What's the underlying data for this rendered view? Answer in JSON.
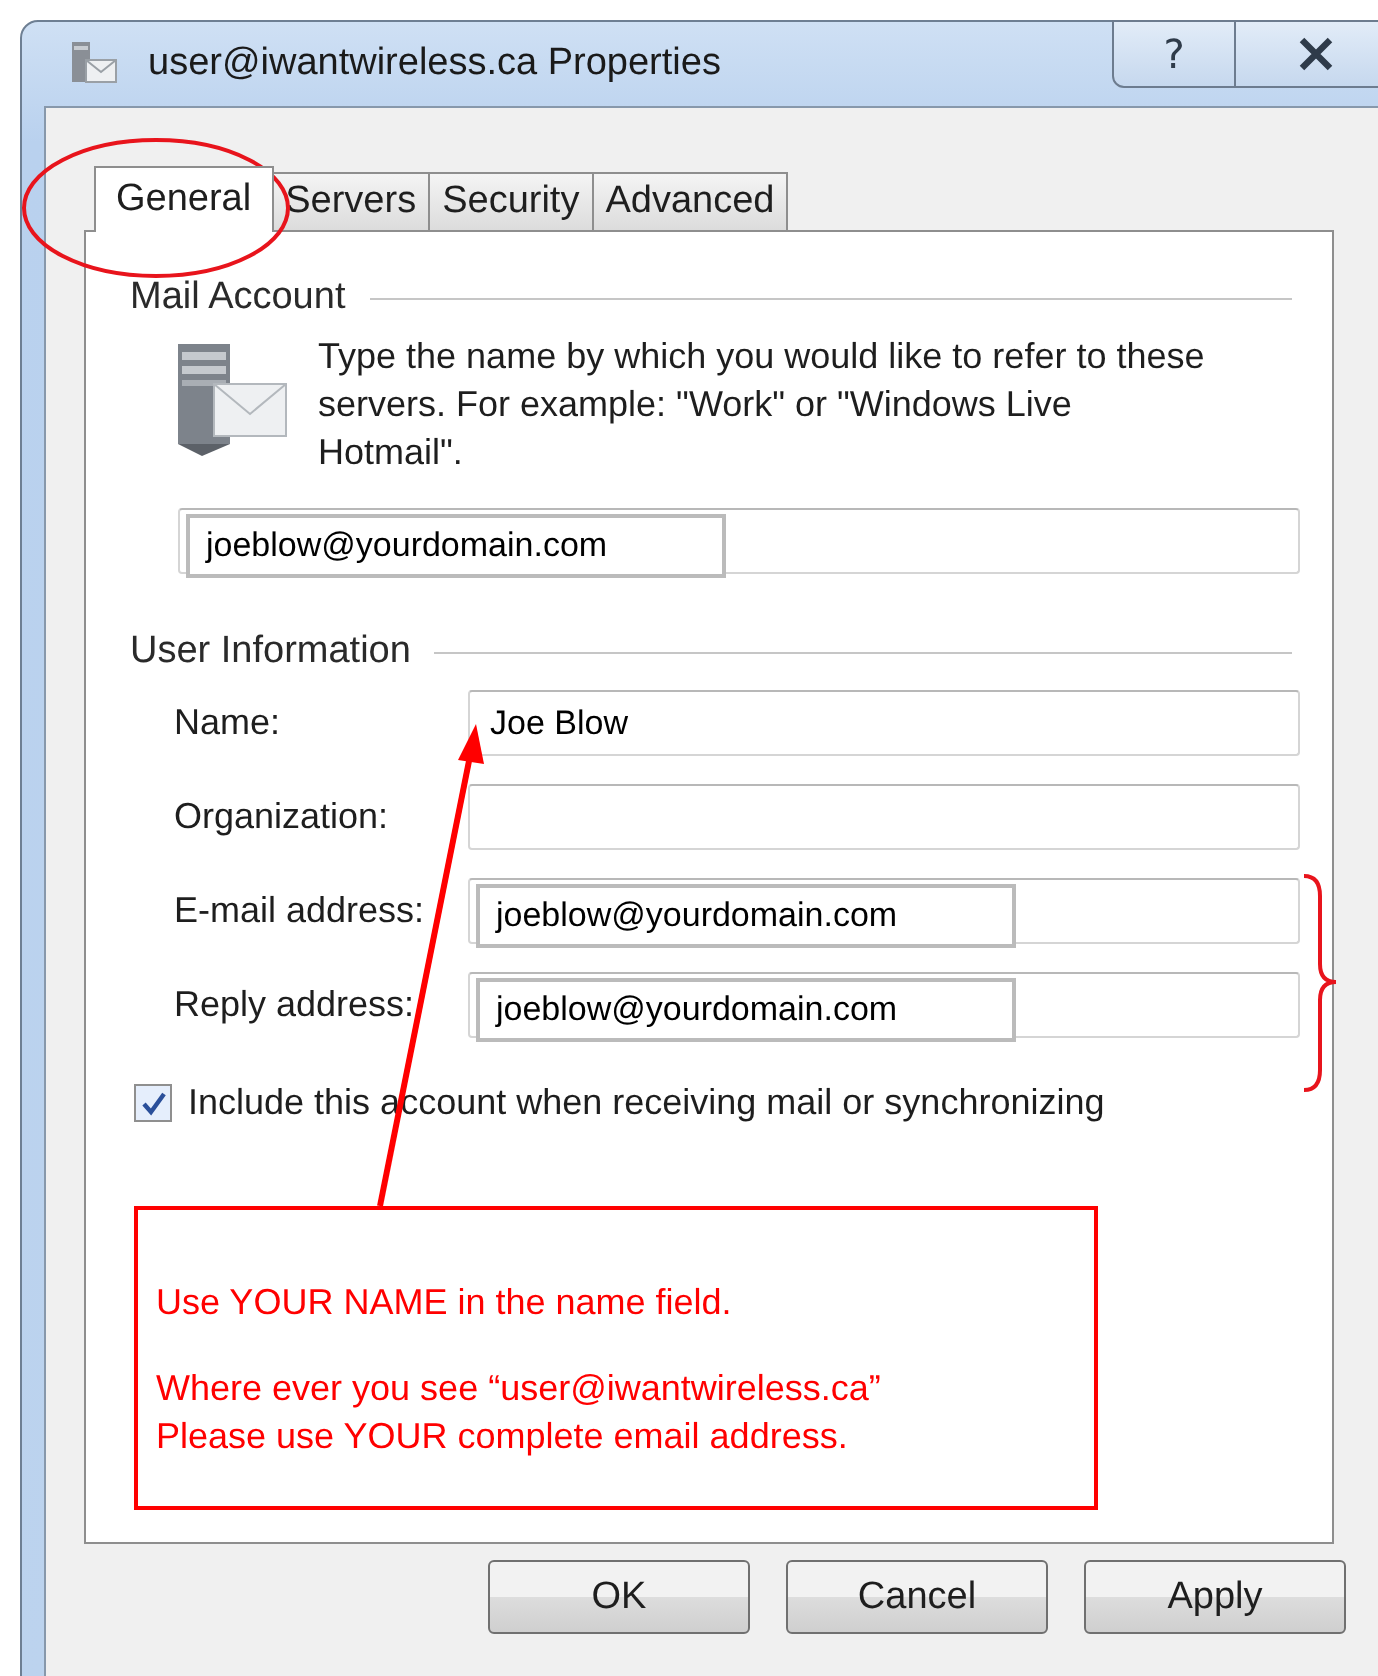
{
  "window": {
    "title": "user@iwantwireless.ca Properties",
    "help_button": "?"
  },
  "tabs": [
    {
      "label": "General",
      "selected": true
    },
    {
      "label": "Servers",
      "selected": false
    },
    {
      "label": "Security",
      "selected": false
    },
    {
      "label": "Advanced",
      "selected": false
    }
  ],
  "mail_account": {
    "heading": "Mail Account",
    "description": "Type the name by which you would like to refer to these servers.  For example: \"Work\" or \"Windows Live Hotmail\".",
    "field": {
      "value": "joeblow@yourdomain.com",
      "kind": "pasted"
    }
  },
  "user_information": {
    "heading": "User Information",
    "fields": [
      {
        "label": "Name:",
        "value": "Joe Blow",
        "kind": "typed"
      },
      {
        "label": "Organization:"
      },
      {
        "label": "E-mail address:",
        "value": "joeblow@yourdomain.com",
        "kind": "pasted"
      },
      {
        "label": "Reply address:",
        "value": "joeblow@yourdomain.com",
        "kind": "pasted"
      }
    ]
  },
  "include_checkbox": {
    "label": "Include this account when receiving mail or synchronizing",
    "checked": true
  },
  "buttons": [
    "OK",
    "Cancel",
    "Apply"
  ],
  "annotation": {
    "notes": [
      "Use YOUR NAME in the name field.",
      "Where ever you see “user@iwantwireless.ca”\nPlease use YOUR complete email address."
    ]
  }
}
